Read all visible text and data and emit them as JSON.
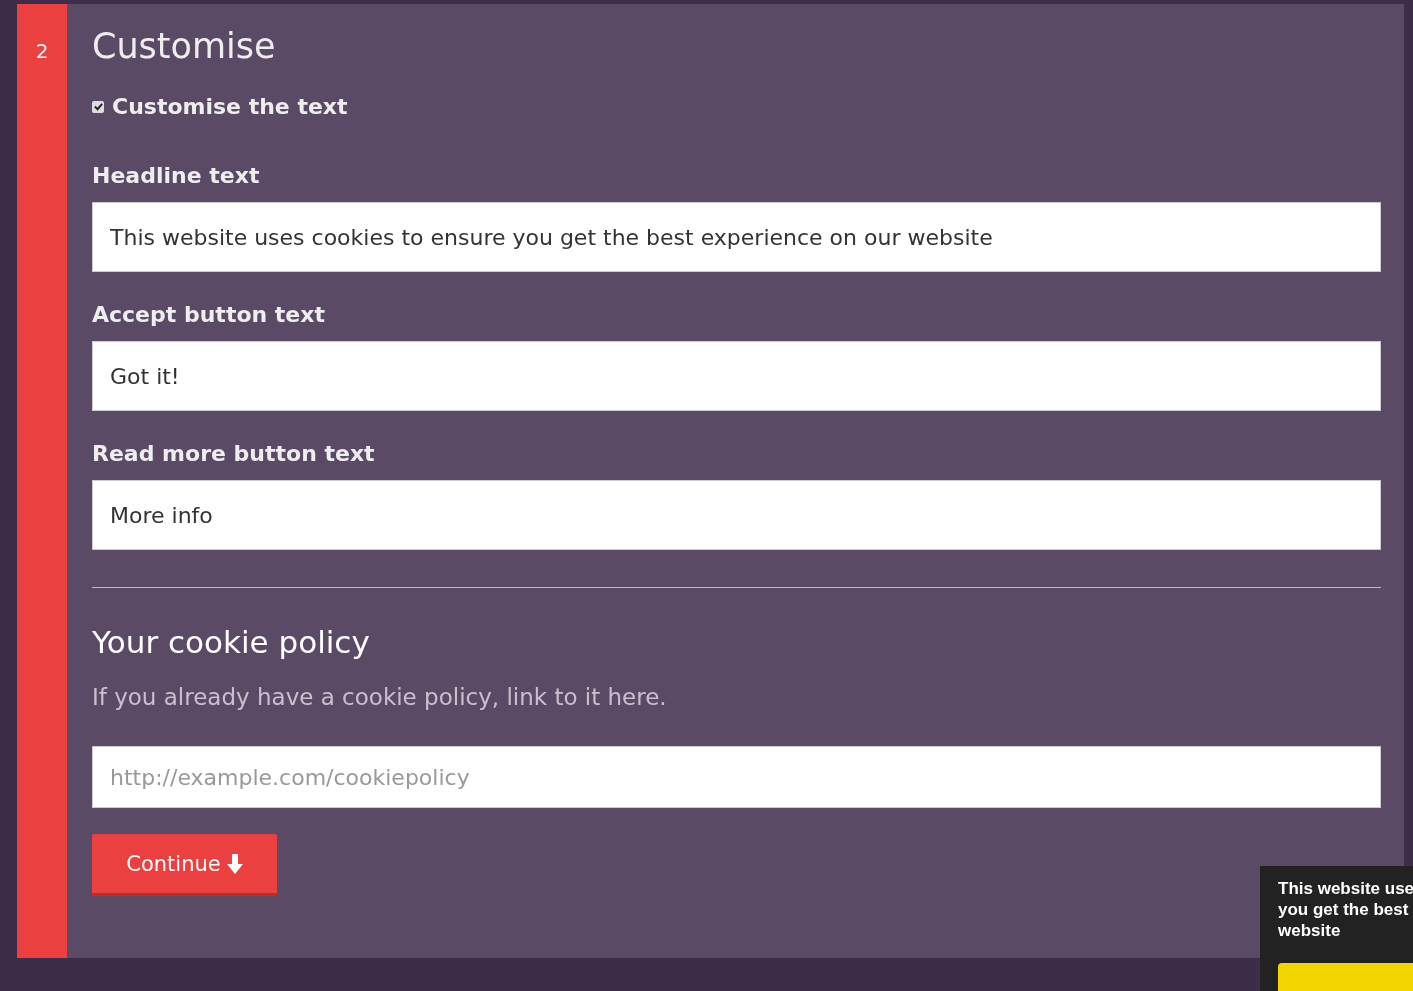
{
  "step": {
    "number": "2",
    "title": "Customise"
  },
  "customise_checkbox": {
    "label": "Customise the text",
    "checked": true
  },
  "fields": [
    {
      "label": "Headline text",
      "value": "This website uses cookies to ensure you get the best experience on our website"
    },
    {
      "label": "Accept button text",
      "value": "Got it!"
    },
    {
      "label": "Read more button text",
      "value": "More info"
    }
  ],
  "policy": {
    "title": "Your cookie policy",
    "description": "If you already have a cookie policy, link to it here.",
    "placeholder": "http://example.com/cookiepolicy"
  },
  "continue_button": {
    "label": "Continue"
  },
  "cookie_banner": {
    "lines": [
      "This website use",
      "you get the best",
      "website"
    ]
  }
}
